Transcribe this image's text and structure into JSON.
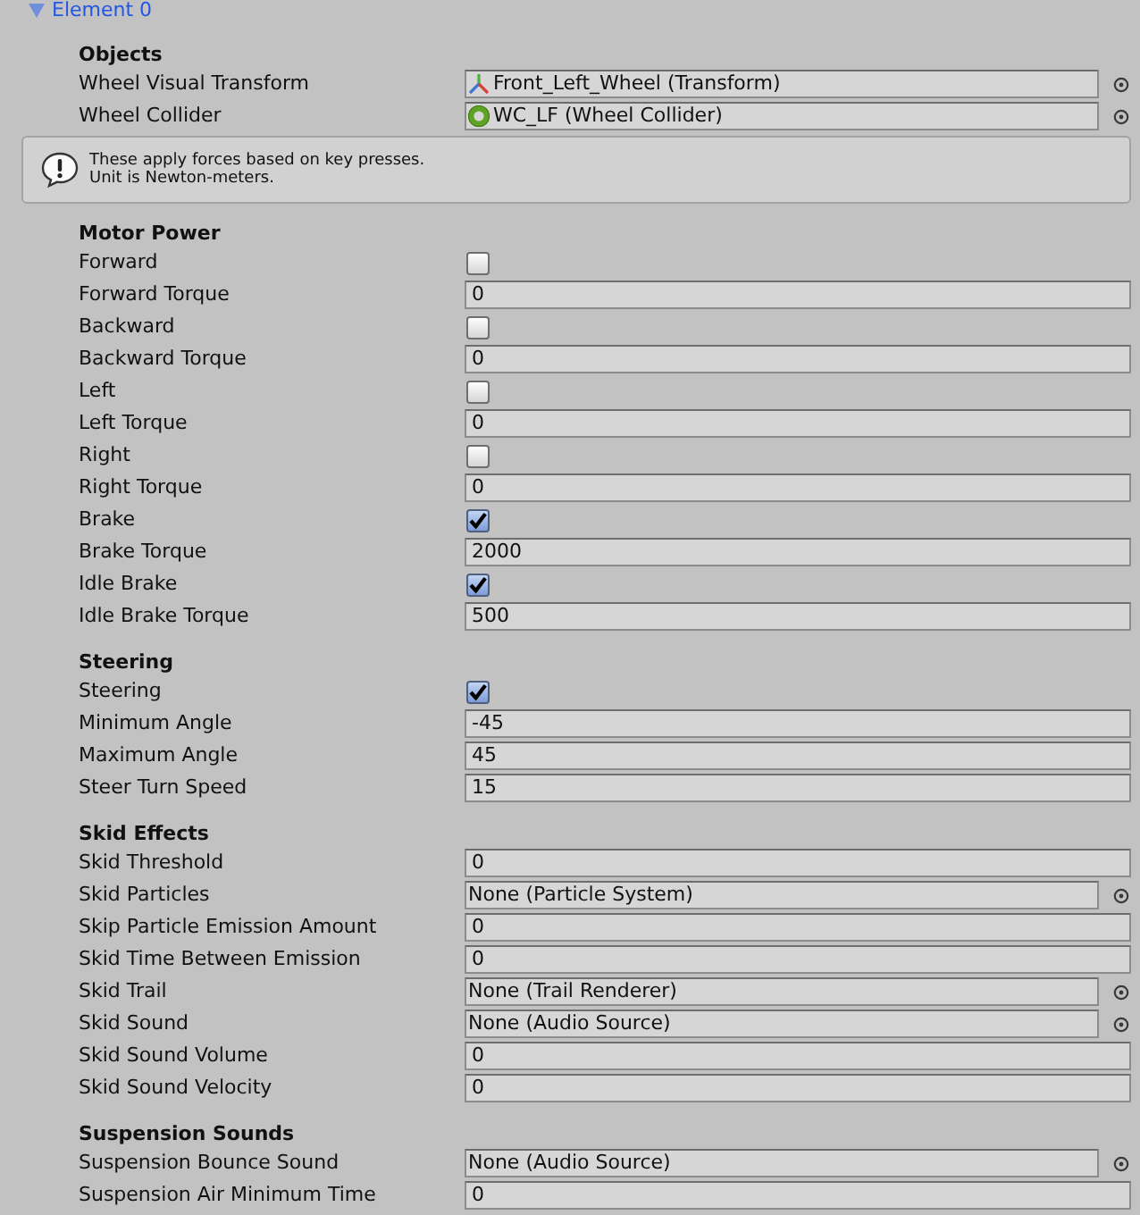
{
  "foldout": {
    "label": "Element 0",
    "expanded": true
  },
  "blocks": [
    {
      "kind": "group",
      "title": "Objects",
      "fields": [
        {
          "label": "Wheel Visual Transform",
          "kind": "transform",
          "value": "Front_Left_Wheel (Transform)"
        },
        {
          "label": "Wheel Collider",
          "kind": "collider",
          "value": "WC_LF (Wheel Collider)"
        }
      ]
    },
    {
      "kind": "help",
      "text": "These apply forces based on key presses.\nUnit is Newton-meters."
    },
    {
      "kind": "group",
      "title": "Motor Power",
      "fields": [
        {
          "label": "Forward",
          "kind": "toggle",
          "checked": false
        },
        {
          "label": "Forward Torque",
          "kind": "number",
          "value": "0"
        },
        {
          "label": "Backward",
          "kind": "toggle",
          "checked": false
        },
        {
          "label": "Backward Torque",
          "kind": "number",
          "value": "0"
        },
        {
          "label": "Left",
          "kind": "toggle",
          "checked": false
        },
        {
          "label": "Left Torque",
          "kind": "number",
          "value": "0"
        },
        {
          "label": "Right",
          "kind": "toggle",
          "checked": false
        },
        {
          "label": "Right Torque",
          "kind": "number",
          "value": "0"
        },
        {
          "label": "Brake",
          "kind": "toggle",
          "checked": true
        },
        {
          "label": "Brake Torque",
          "kind": "number",
          "value": "2000"
        },
        {
          "label": "Idle Brake",
          "kind": "toggle",
          "checked": true
        },
        {
          "label": "Idle Brake Torque",
          "kind": "number",
          "value": "500"
        }
      ]
    },
    {
      "kind": "group",
      "title": "Steering",
      "fields": [
        {
          "label": "Steering",
          "kind": "toggle",
          "checked": true
        },
        {
          "label": "Minimum Angle",
          "kind": "number",
          "value": "-45"
        },
        {
          "label": "Maximum Angle",
          "kind": "number",
          "value": "45"
        },
        {
          "label": "Steer Turn Speed",
          "kind": "number",
          "value": "15"
        }
      ]
    },
    {
      "kind": "group",
      "title": "Skid Effects",
      "fields": [
        {
          "label": "Skid Threshold",
          "kind": "number",
          "value": "0"
        },
        {
          "label": "Skid Particles",
          "kind": "object",
          "value": "None (Particle System)"
        },
        {
          "label": "Skip Particle Emission Amount",
          "kind": "number",
          "value": "0"
        },
        {
          "label": "Skid Time Between Emission",
          "kind": "number",
          "value": "0"
        },
        {
          "label": "Skid Trail",
          "kind": "object",
          "value": "None (Trail Renderer)"
        },
        {
          "label": "Skid Sound",
          "kind": "object",
          "value": "None (Audio Source)"
        },
        {
          "label": "Skid Sound Volume",
          "kind": "number",
          "value": "0"
        },
        {
          "label": "Skid Sound Velocity",
          "kind": "number",
          "value": "0"
        }
      ]
    },
    {
      "kind": "group",
      "title": "Suspension Sounds",
      "fields": [
        {
          "label": "Suspension Bounce Sound",
          "kind": "object",
          "value": "None (Audio Source)"
        },
        {
          "label": "Suspension Air Minimum Time",
          "kind": "number",
          "value": "0"
        }
      ]
    }
  ]
}
